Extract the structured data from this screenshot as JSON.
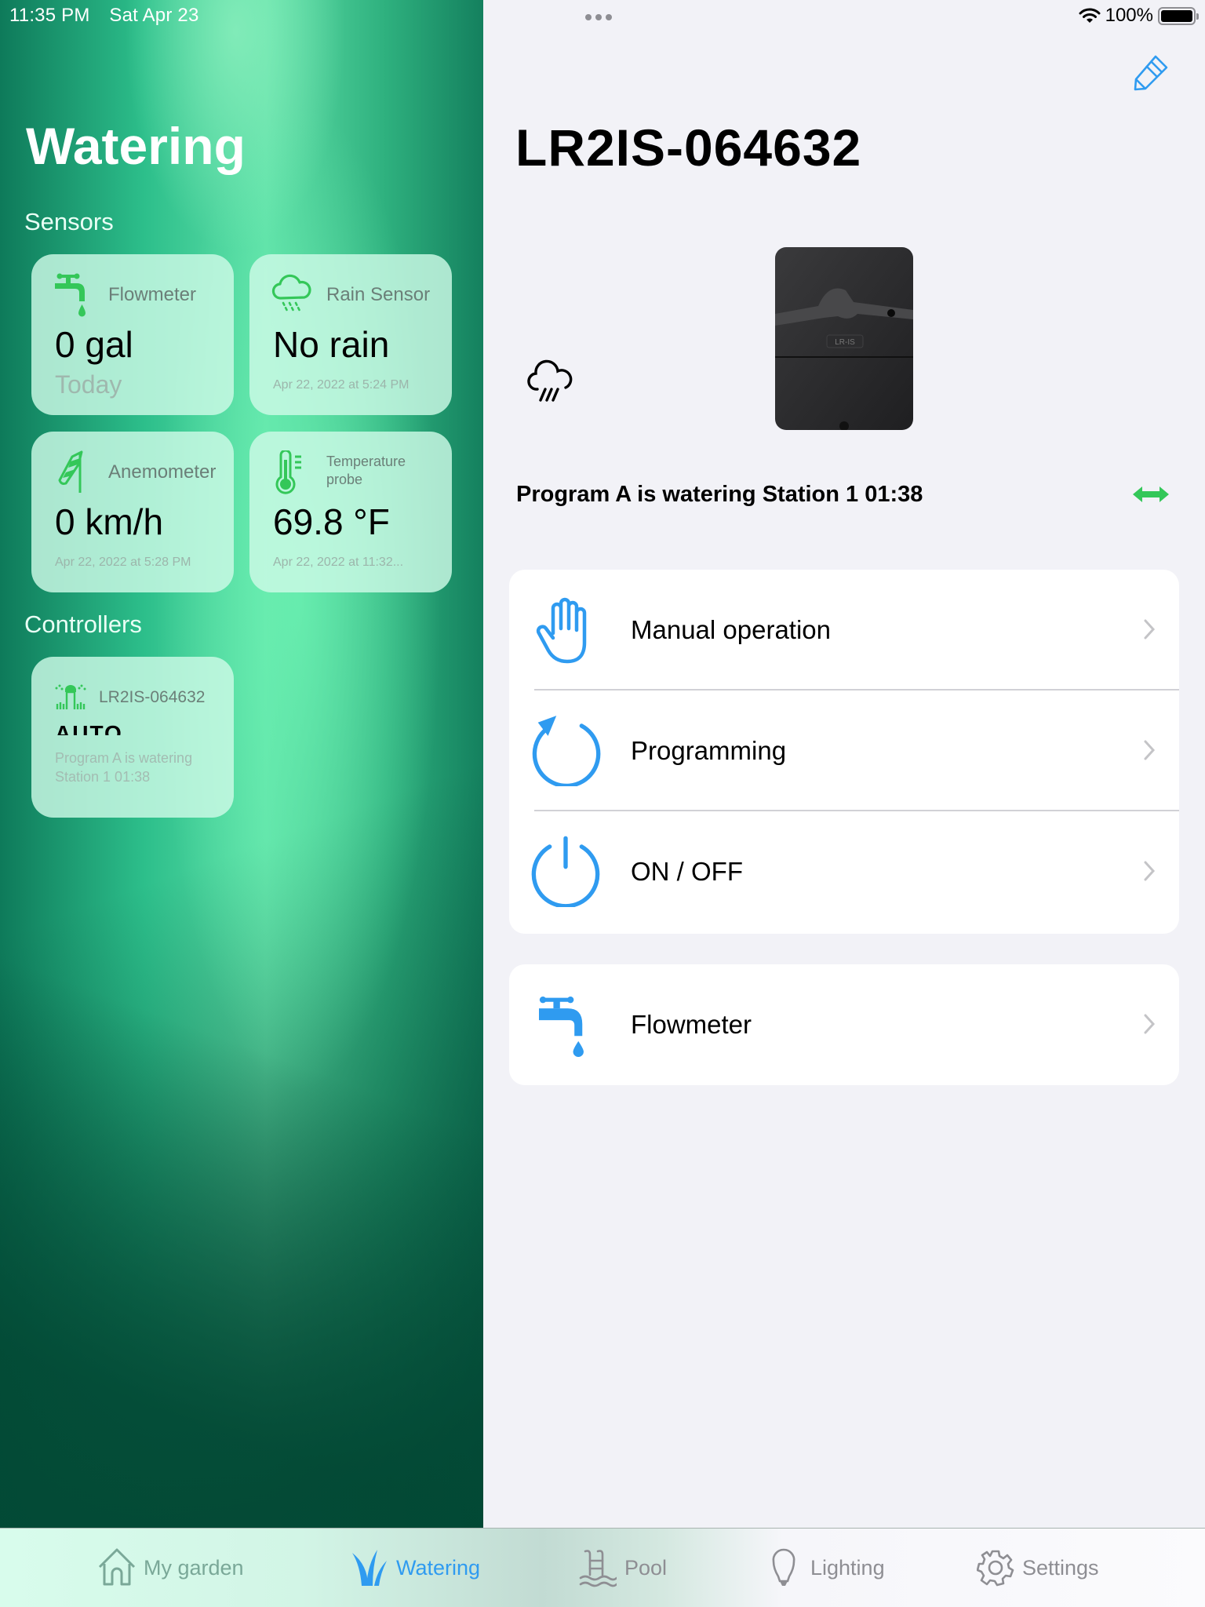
{
  "status_bar": {
    "time": "11:35 PM",
    "date": "Sat Apr 23",
    "battery": "100%",
    "battery_level_percent": 100
  },
  "sidebar": {
    "title": "Watering",
    "sensors_label": "Sensors",
    "controllers_label": "Controllers",
    "sensors": [
      {
        "name": "Flowmeter",
        "icon": "faucet-icon",
        "value": "0 gal",
        "sub": "Today"
      },
      {
        "name": "Rain Sensor",
        "icon": "cloud-rain-icon",
        "value": "No rain",
        "date": "Apr 22, 2022 at 5:24 PM"
      },
      {
        "name": "Anemometer",
        "icon": "windsock-icon",
        "value": "0 km/h",
        "date": "Apr 22, 2022 at 5:28 PM"
      },
      {
        "name": "Temperature probe",
        "icon": "thermometer-icon",
        "value": "69.8 °F",
        "date": "Apr 22, 2022 at 11:32..."
      }
    ],
    "controllers": [
      {
        "name": "LR2IS-064632",
        "icon": "sprinkler-icon",
        "mode": "AUTO",
        "status": "Program A is watering Station 1 01:38"
      }
    ]
  },
  "detail": {
    "title": "LR2IS-064632",
    "edit_icon": "pencil-icon",
    "weather_icon": "cloud-rain-icon",
    "device_badge": "LR-IS",
    "status": "Program A is watering Station 1 01:38",
    "connection_icon": "double-arrow-icon",
    "menu": [
      {
        "label": "Manual operation",
        "icon": "hand-icon"
      },
      {
        "label": "Programming",
        "icon": "refresh-circle-icon"
      },
      {
        "label": "ON / OFF",
        "icon": "power-icon"
      }
    ],
    "menu2": [
      {
        "label": "Flowmeter",
        "icon": "faucet-icon"
      }
    ]
  },
  "tabs": [
    {
      "label": "My garden",
      "icon": "house-icon",
      "active": false
    },
    {
      "label": "Watering",
      "icon": "grass-icon",
      "active": true
    },
    {
      "label": "Pool",
      "icon": "pool-ladder-icon",
      "active": false
    },
    {
      "label": "Lighting",
      "icon": "lightbulb-icon",
      "active": false
    },
    {
      "label": "Settings",
      "icon": "gear-icon",
      "active": false
    }
  ],
  "colors": {
    "accent_blue": "#2f9bf0",
    "sensor_green": "#34c759",
    "connection_green": "#34c759"
  }
}
